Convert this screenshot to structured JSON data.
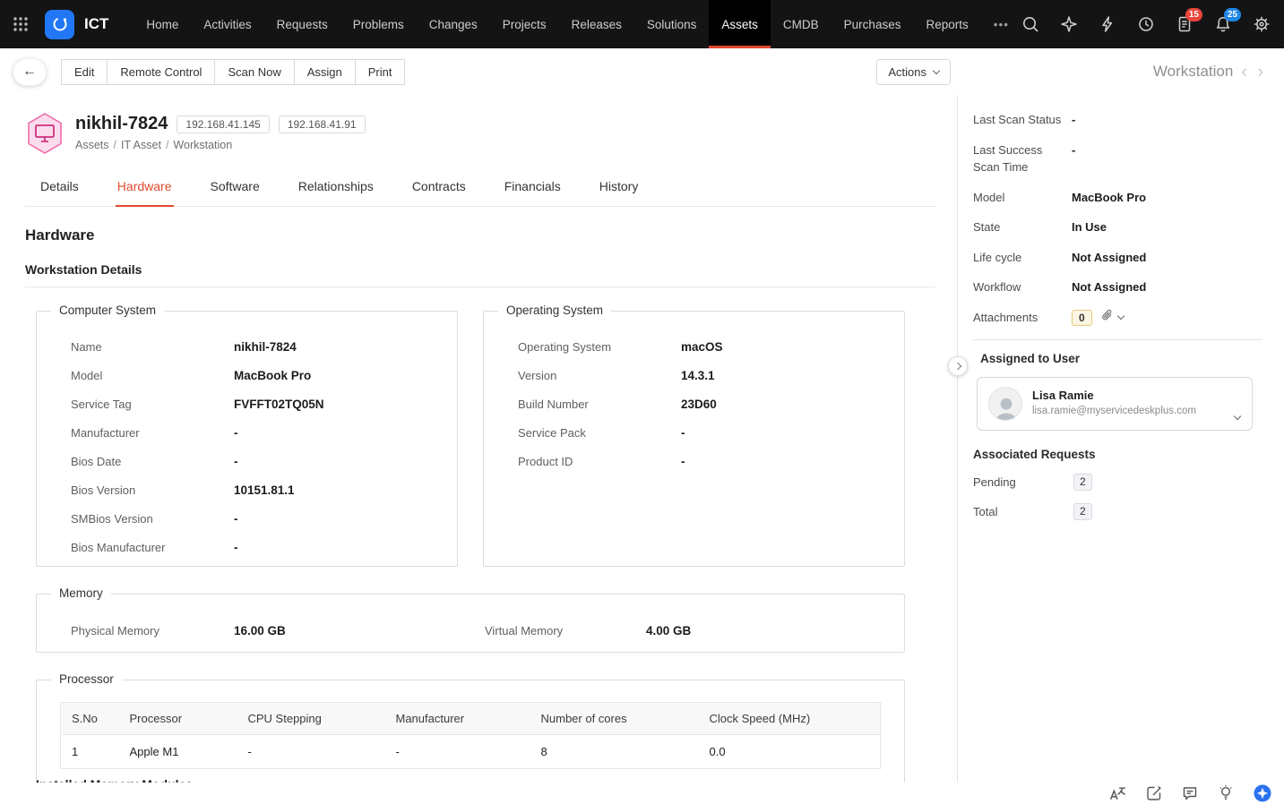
{
  "colors": {
    "accent_red": "#e0492d",
    "badge_red": "#e8453c",
    "badge_blue": "#1e88e5",
    "asset_pink": "#cf2e7f",
    "navbar_bg": "#141414",
    "status_green": "#35b54a"
  },
  "navbar": {
    "brand": "ICT",
    "items": [
      "Home",
      "Activities",
      "Requests",
      "Problems",
      "Changes",
      "Projects",
      "Releases",
      "Solutions",
      "Assets",
      "CMDB",
      "Purchases",
      "Reports",
      "•••"
    ],
    "active_item": "Assets",
    "approvals_badge": "15",
    "notifications_badge": "25"
  },
  "toolbar": {
    "back_icon": "←",
    "buttons": [
      "Edit",
      "Remote Control",
      "Scan Now",
      "Assign",
      "Print"
    ],
    "actions_label": "Actions",
    "record_type": "Workstation",
    "prev_icon": "‹",
    "next_icon": "›"
  },
  "asset": {
    "name": "nikhil-7824",
    "ips": [
      "192.168.41.145",
      "192.168.41.91"
    ],
    "breadcrumb": [
      "Assets",
      "IT Asset",
      "Workstation"
    ],
    "breadcrumb_separator": "/"
  },
  "tabs": {
    "items": [
      "Details",
      "Hardware",
      "Software",
      "Relationships",
      "Contracts",
      "Financials",
      "History"
    ],
    "active": "Hardware"
  },
  "hardware": {
    "title": "Hardware",
    "subtitle": "Workstation Details",
    "computer_system": {
      "title": "Computer System",
      "fields": [
        {
          "label": "Name",
          "value": "nikhil-7824"
        },
        {
          "label": "Model",
          "value": "MacBook Pro"
        },
        {
          "label": "Service Tag",
          "value": "FVFFT02TQ05N"
        },
        {
          "label": "Manufacturer",
          "value": "-"
        },
        {
          "label": "Bios Date",
          "value": "-"
        },
        {
          "label": "Bios Version",
          "value": "10151.81.1"
        },
        {
          "label": "SMBios Version",
          "value": "-"
        },
        {
          "label": "Bios Manufacturer",
          "value": "-"
        }
      ]
    },
    "operating_system": {
      "title": "Operating System",
      "fields": [
        {
          "label": "Operating System",
          "value": "macOS"
        },
        {
          "label": "Version",
          "value": "14.3.1"
        },
        {
          "label": "Build Number",
          "value": "23D60"
        },
        {
          "label": "Service Pack",
          "value": "-"
        },
        {
          "label": "Product ID",
          "value": "-"
        }
      ]
    },
    "memory": {
      "title": "Memory",
      "fields": [
        {
          "label": "Physical Memory",
          "value": "16.00 GB"
        },
        {
          "label": "Virtual Memory",
          "value": "4.00 GB"
        }
      ]
    },
    "processor": {
      "title": "Processor",
      "headers": [
        "S.No",
        "Processor",
        "CPU Stepping",
        "Manufacturer",
        "Number of cores",
        "Clock Speed (MHz)"
      ],
      "rows": [
        [
          "1",
          "Apple M1",
          "-",
          "-",
          "8",
          "0.0"
        ]
      ]
    },
    "next_section_title": "Installed Memory Modules"
  },
  "sidebar": {
    "fields": [
      {
        "label": "Last Scan Status",
        "value": "-"
      },
      {
        "label": "Last Success Scan Time",
        "value": "-"
      },
      {
        "label": "Model",
        "value": "MacBook Pro"
      },
      {
        "label": "State",
        "value": "In Use"
      },
      {
        "label": "Life cycle",
        "value": "Not Assigned"
      },
      {
        "label": "Workflow",
        "value": "Not Assigned"
      }
    ],
    "attachments": {
      "label": "Attachments",
      "count": "0"
    },
    "assigned_user": {
      "title": "Assigned to User",
      "name": "Lisa Ramie",
      "email": "lisa.ramie@myservicedeskplus.com"
    },
    "associated_requests": {
      "title": "Associated Requests",
      "rows": [
        {
          "label": "Pending",
          "count": "2"
        },
        {
          "label": "Total",
          "count": "2"
        }
      ]
    }
  }
}
